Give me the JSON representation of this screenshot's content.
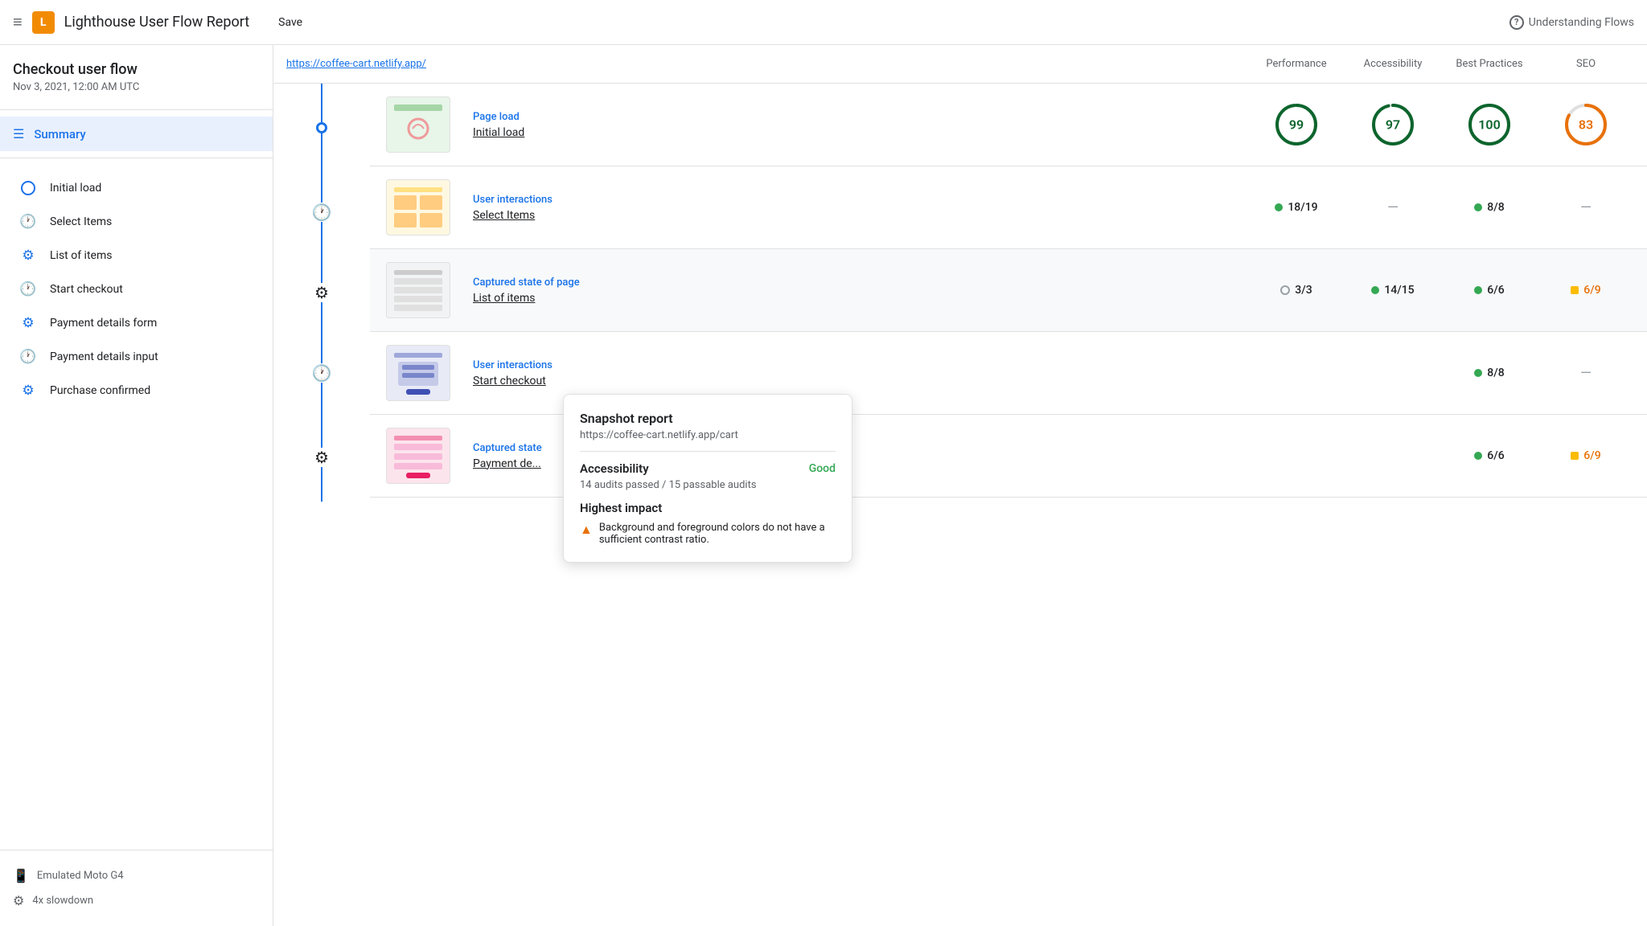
{
  "topbar": {
    "menu_icon": "≡",
    "logo_text": "L",
    "title": "Lighthouse User Flow Report",
    "save_label": "Save",
    "help_icon": "?",
    "help_label": "Understanding Flows"
  },
  "sidebar": {
    "flow_title": "Checkout user flow",
    "flow_date": "Nov 3, 2021, 12:00 AM UTC",
    "summary_label": "Summary",
    "nav_items": [
      {
        "id": "initial-load",
        "label": "Initial load",
        "icon": "circle"
      },
      {
        "id": "select-items",
        "label": "Select Items",
        "icon": "clock"
      },
      {
        "id": "list-of-items",
        "label": "List of items",
        "icon": "snapshot"
      },
      {
        "id": "start-checkout",
        "label": "Start checkout",
        "icon": "clock"
      },
      {
        "id": "payment-details-form",
        "label": "Payment details form",
        "icon": "snapshot"
      },
      {
        "id": "payment-details-input",
        "label": "Payment details input",
        "icon": "clock"
      },
      {
        "id": "purchase-confirmed",
        "label": "Purchase confirmed",
        "icon": "snapshot"
      }
    ],
    "footer_items": [
      {
        "id": "emulated-moto",
        "label": "Emulated Moto G4",
        "icon": "📱"
      },
      {
        "id": "slowdown",
        "label": "4x slowdown",
        "icon": "⚙"
      }
    ]
  },
  "col_headers": {
    "url": "https://coffee-cart.netlify.app/",
    "performance": "Performance",
    "accessibility": "Accessibility",
    "best_practices": "Best Practices",
    "seo": "SEO"
  },
  "flow_rows": [
    {
      "id": "page-load",
      "type": "Page load",
      "name": "Initial load",
      "timeline_node": "circle",
      "scores": {
        "performance": {
          "type": "circle",
          "value": 99,
          "color": "green"
        },
        "accessibility": {
          "type": "circle",
          "value": 97,
          "color": "green"
        },
        "best_practices": {
          "type": "circle",
          "value": 100,
          "color": "green"
        },
        "seo": {
          "type": "circle",
          "value": 83,
          "color": "orange"
        }
      }
    },
    {
      "id": "user-interactions-1",
      "type": "User interactions",
      "name": "Select Items",
      "timeline_node": "clock",
      "scores": {
        "performance": {
          "type": "badge",
          "value": "18/19",
          "dot": "green"
        },
        "accessibility": {
          "type": "dash"
        },
        "best_practices": {
          "type": "badge",
          "value": "8/8",
          "dot": "green"
        },
        "seo": {
          "type": "dash"
        }
      }
    },
    {
      "id": "captured-state-1",
      "type": "Captured state of page",
      "name": "List of items",
      "timeline_node": "snapshot",
      "scores": {
        "performance": {
          "type": "open-circle",
          "value": "3/3"
        },
        "accessibility": {
          "type": "badge",
          "value": "14/15",
          "dot": "green"
        },
        "best_practices": {
          "type": "badge",
          "value": "6/6",
          "dot": "green"
        },
        "seo": {
          "type": "badge-square",
          "value": "6/9"
        }
      }
    },
    {
      "id": "user-interactions-2",
      "type": "User interactions",
      "name": "Start checkout",
      "timeline_node": "clock",
      "scores": {
        "performance": {
          "type": "hidden"
        },
        "accessibility": {
          "type": "hidden"
        },
        "best_practices": {
          "type": "badge",
          "value": "8/8",
          "dot": "green"
        },
        "seo": {
          "type": "dash"
        }
      }
    },
    {
      "id": "captured-state-2",
      "type": "Captured state",
      "name": "Payment de...",
      "timeline_node": "snapshot",
      "scores": {
        "performance": {
          "type": "hidden"
        },
        "accessibility": {
          "type": "hidden"
        },
        "best_practices": {
          "type": "badge",
          "value": "6/6",
          "dot": "green"
        },
        "seo": {
          "type": "badge-square",
          "value": "6/9"
        }
      }
    }
  ],
  "tooltip": {
    "title": "Snapshot report",
    "url": "https://coffee-cart.netlify.app/cart",
    "accessibility_label": "Accessibility",
    "accessibility_status": "Good",
    "accessibility_desc": "14 audits passed / 15 passable audits",
    "highest_impact_label": "Highest impact",
    "impact_warning": "▲",
    "impact_text": "Background and foreground colors do not have a sufficient contrast ratio."
  }
}
